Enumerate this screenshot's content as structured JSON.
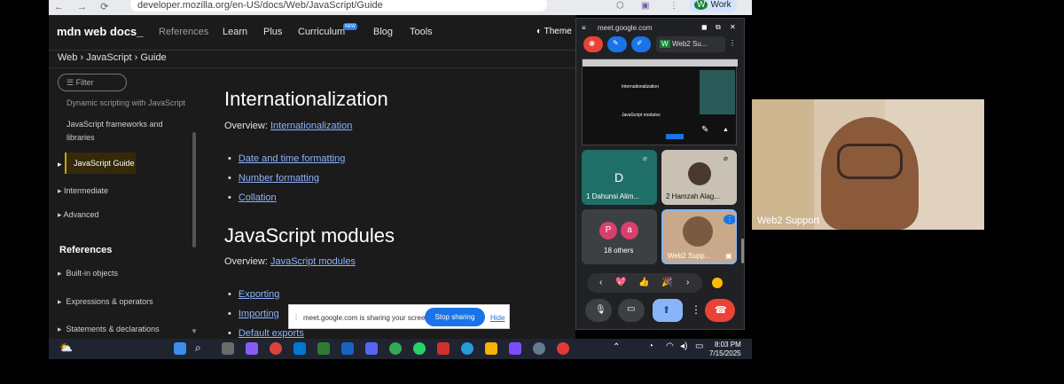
{
  "browser": {
    "nav": "← → ⟳",
    "url": "developer.mozilla.org/en-US/docs/Web/JavaScript/Guide",
    "profile": "Work",
    "profile_letter": "W"
  },
  "mdn": {
    "logo": "mdn web docs_",
    "topnav": [
      "References",
      "Learn",
      "Plus",
      "Curriculum",
      "Blog",
      "Tools"
    ],
    "new_badge": "NEW",
    "theme": "Theme",
    "breadcrumb": "Web  ›  JavaScript  ›  Guide",
    "filter_placeholder": "Filter",
    "sidebar": {
      "item1": "Dynamic scripting with JavaScript",
      "item2a": "JavaScript frameworks and",
      "item2b": "libraries",
      "active": "JavaScript Guide",
      "intermediate": "Intermediate",
      "advanced": "Advanced",
      "references_heading": "References",
      "builtins": "Built-in objects",
      "expressions": "Expressions & operators",
      "statements": "Statements & declarations"
    },
    "content": {
      "h_intl": "Internationalization",
      "overview_label": "Overview:",
      "overview_intl": "Internationalization",
      "intl_links": [
        "Date and time formatting",
        "Number formatting",
        "Collation"
      ],
      "h_modules": "JavaScript modules",
      "overview_modules": "JavaScript modules",
      "module_links": [
        "Exporting",
        "Importing",
        "Default exports"
      ]
    }
  },
  "share_bar": {
    "message": "meet.google.com is sharing your screen.",
    "stop": "Stop sharing",
    "hide": "Hide"
  },
  "meet": {
    "url": "meet.google.com",
    "tab_label": "Web2 Su...",
    "preview_title": "Internationalization",
    "preview_sub": "JavaScript modules",
    "tiles": [
      {
        "initial": "D",
        "label": "1 Dahunsi Alim..."
      },
      {
        "label": "2 Hamzah Alag..."
      },
      {
        "label": "18 others",
        "a": "P",
        "b": "a"
      },
      {
        "label": "Web2 Supp..."
      }
    ],
    "reactions": [
      "‹",
      "💖",
      "👍",
      "🎉",
      "›"
    ]
  },
  "taskbar": {
    "time": "8:03 PM",
    "date": "7/15/2025"
  },
  "camera": {
    "name": "Web2 Support"
  },
  "colors": {
    "link": "#8cb4ff",
    "meet_stop": "#1a73e8",
    "end_call": "#ea4335"
  }
}
